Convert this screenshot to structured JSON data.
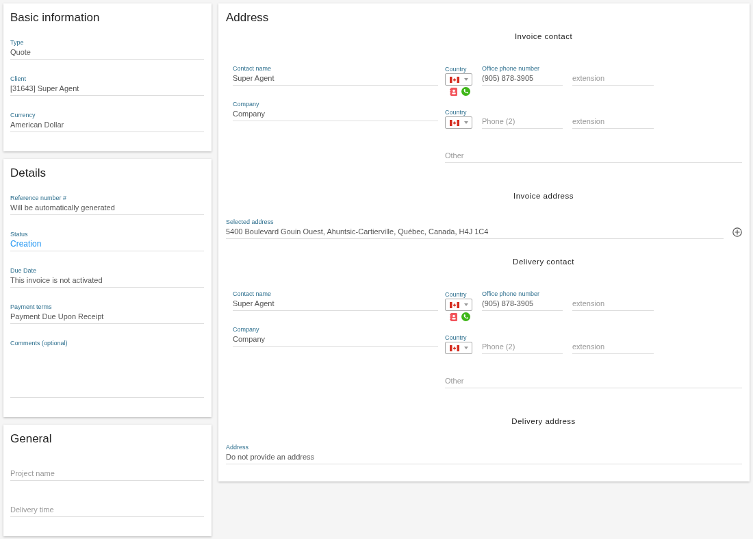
{
  "basic_information": {
    "title": "Basic information",
    "fields": [
      {
        "kind": "text",
        "label": "Type",
        "value": "Quote"
      },
      {
        "kind": "text",
        "label": "Client",
        "value": "[31643] Super Agent"
      },
      {
        "kind": "text",
        "label": "Currency",
        "value": "American Dollar"
      }
    ]
  },
  "details": {
    "title": "Details",
    "fields": [
      {
        "kind": "text",
        "label": "Reference number #",
        "value": "Will be automatically generated"
      },
      {
        "kind": "status",
        "label": "Status",
        "value": "Creation"
      },
      {
        "kind": "text",
        "label": "Due Date",
        "value": "This invoice is not activated"
      },
      {
        "kind": "text",
        "label": "Payment terms",
        "value": "Payment Due Upon Receipt"
      },
      {
        "kind": "textarea",
        "label": "Comments (optional)"
      }
    ]
  },
  "general": {
    "title": "General",
    "fields": [
      {
        "kind": "text",
        "placeholder": "Project name"
      },
      {
        "kind": "text",
        "placeholder": "Delivery time"
      }
    ]
  },
  "address": {
    "title": "Address",
    "sections": [
      {
        "kind": "contact",
        "heading": "Invoice contact",
        "contact_name": {
          "label": "Contact name",
          "value": "Super Agent"
        },
        "company": {
          "label": "Company",
          "value": "Company"
        },
        "country": {
          "label": "Country"
        },
        "phone": {
          "label": "Office phone number",
          "value": "(905) 878-3905"
        },
        "extension": {
          "placeholder": "extension"
        },
        "country_2": {
          "label": "Country"
        },
        "phone_2": {
          "placeholder": "Phone (2)"
        },
        "extension_2": {
          "placeholder": "extension"
        },
        "other": {
          "placeholder": "Other"
        }
      },
      {
        "kind": "selected_address",
        "heading": "Invoice address",
        "label": "Selected address",
        "value": "5400 Boulevard Gouin Ouest, Ahuntsic-Cartierville, Québec, Canada, H4J 1C4"
      },
      {
        "kind": "contact",
        "heading": "Delivery contact",
        "contact_name": {
          "label": "Contact name",
          "value": "Super Agent"
        },
        "company": {
          "label": "Company",
          "value": "Company"
        },
        "country": {
          "label": "Country"
        },
        "phone": {
          "label": "Office phone number",
          "value": "(905) 878-3905"
        },
        "extension": {
          "placeholder": "extension"
        },
        "country_2": {
          "label": "Country"
        },
        "phone_2": {
          "placeholder": "Phone (2)"
        },
        "extension_2": {
          "placeholder": "extension"
        },
        "other": {
          "placeholder": "Other"
        }
      },
      {
        "kind": "address",
        "heading": "Delivery address",
        "label": "Address",
        "value": "Do not provide an address"
      }
    ]
  }
}
